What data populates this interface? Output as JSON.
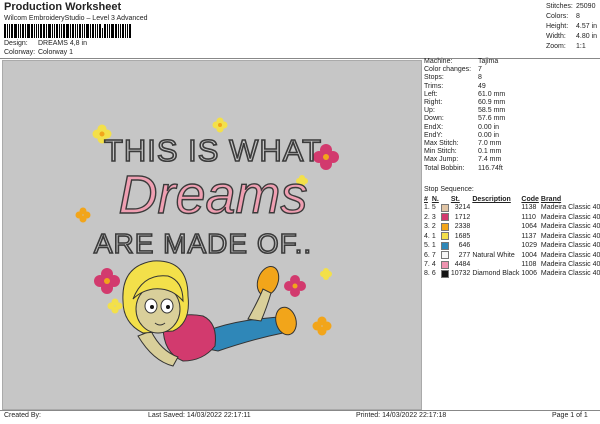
{
  "header": {
    "title": "Production Worksheet",
    "subtitle": "Wilcom EmbroideryStudio – Level 3 Advanced",
    "design_label": "Design:",
    "design_value": "DREAMS 4,8 in",
    "colorway_label": "Colorway:",
    "colorway_value": "Colorway 1"
  },
  "stats": [
    {
      "label": "Stitches:",
      "value": "25090"
    },
    {
      "label": "Colors:",
      "value": "8"
    },
    {
      "label": "Height:",
      "value": "4.57 in"
    },
    {
      "label": "Width:",
      "value": "4.80 in"
    },
    {
      "label": "Zoom:",
      "value": "1:1"
    }
  ],
  "details": [
    {
      "label": "Machine:",
      "value": "Tajima"
    },
    {
      "label": "Color changes:",
      "value": "7"
    },
    {
      "label": "Stops:",
      "value": "8"
    },
    {
      "label": "Trims:",
      "value": "49"
    },
    {
      "label": "Left:",
      "value": "61.0 mm"
    },
    {
      "label": "Right:",
      "value": "60.9 mm"
    },
    {
      "label": "Up:",
      "value": "58.5 mm"
    },
    {
      "label": "Down:",
      "value": "57.6 mm"
    },
    {
      "label": "EndX:",
      "value": "0.00 in"
    },
    {
      "label": "EndY:",
      "value": "0.00 in"
    },
    {
      "label": "Max Stitch:",
      "value": "7.0 mm"
    },
    {
      "label": "Min Stitch:",
      "value": "0.1 mm"
    },
    {
      "label": "Max Jump:",
      "value": "7.4 mm"
    },
    {
      "label": "Total Bobbin:",
      "value": "116.74ft"
    }
  ],
  "stop_sequence": {
    "label": "Stop Sequence:",
    "columns": [
      "#",
      "N.",
      "",
      "St.",
      "Description",
      "Code",
      "Brand"
    ],
    "rows": [
      {
        "num": "1.",
        "n": "5",
        "color": "#e0c4a4",
        "st": "3214",
        "desc": "",
        "code": "1138",
        "brand": "Madeira Classic 40"
      },
      {
        "num": "2.",
        "n": "3",
        "color": "#d23a6e",
        "st": "1712",
        "desc": "",
        "code": "1110",
        "brand": "Madeira Classic 40"
      },
      {
        "num": "3.",
        "n": "2",
        "color": "#f2a51a",
        "st": "2338",
        "desc": "",
        "code": "1064",
        "brand": "Madeira Classic 40"
      },
      {
        "num": "4.",
        "n": "1",
        "color": "#f3e04a",
        "st": "1685",
        "desc": "",
        "code": "1137",
        "brand": "Madeira Classic 40"
      },
      {
        "num": "5.",
        "n": "1",
        "color": "#2f87b8",
        "st": "646",
        "desc": "",
        "code": "1029",
        "brand": "Madeira Classic 40"
      },
      {
        "num": "6.",
        "n": "7",
        "color": "#f6f6f6",
        "st": "277",
        "desc": "Natural White",
        "code": "1004",
        "brand": "Madeira Classic 40"
      },
      {
        "num": "7.",
        "n": "4",
        "color": "#ee93b0",
        "st": "4484",
        "desc": "",
        "code": "1108",
        "brand": "Madeira Classic 40"
      },
      {
        "num": "8.",
        "n": "6",
        "color": "#141414",
        "st": "10732",
        "desc": "Diamond Black",
        "code": "1006",
        "brand": "Madeira Classic 40"
      }
    ]
  },
  "artwork": {
    "line1": "THIS IS WHAT",
    "line2": "Dreams",
    "line3": "ARE MADE OF..",
    "text_color": "#3a3a3a",
    "script_color": "#ef9fb2",
    "canvas_color": "#c6c6c6"
  },
  "footer": {
    "created_by": "Created By:",
    "last_saved": "Last Saved: 14/03/2022 22:17:11",
    "printed": "Printed: 14/03/2022 22:17:18",
    "page": "Page 1 of 1"
  }
}
